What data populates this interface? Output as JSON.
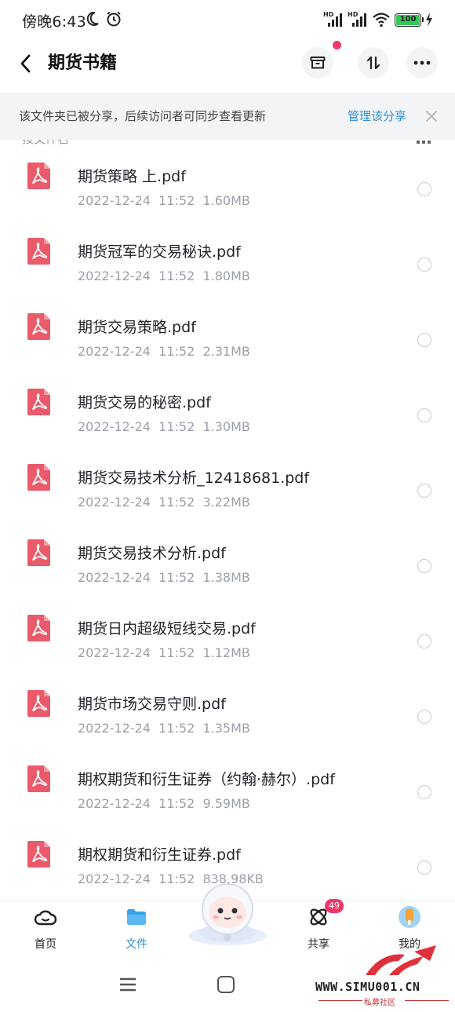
{
  "status_bar": {
    "time": "傍晚6:43",
    "moon_icon": "moon-icon",
    "alarm_icon": "alarm-icon",
    "signal_label_1": "HD",
    "signal_label_2": "HD",
    "battery_level": "100"
  },
  "header": {
    "title": "期货书籍",
    "back_icon": "chevron-left-icon",
    "actions": [
      "archive-box-icon",
      "sort-arrows-icon",
      "more-dots-icon"
    ]
  },
  "banner": {
    "text": "该文件夹已被分享，后续访问者可同步查看更新",
    "link": "管理该分享"
  },
  "sort": {
    "label": "按文件名"
  },
  "files": [
    {
      "name": "期货策略  上.pdf",
      "date": "2022-12-24",
      "time": "11:52",
      "size": "1.60MB"
    },
    {
      "name": "期货冠军的交易秘诀.pdf",
      "date": "2022-12-24",
      "time": "11:52",
      "size": "1.80MB"
    },
    {
      "name": "期货交易策略.pdf",
      "date": "2022-12-24",
      "time": "11:52",
      "size": "2.31MB"
    },
    {
      "name": "期货交易的秘密.pdf",
      "date": "2022-12-24",
      "time": "11:52",
      "size": "1.30MB"
    },
    {
      "name": "期货交易技术分析_12418681.pdf",
      "date": "2022-12-24",
      "time": "11:52",
      "size": "3.22MB"
    },
    {
      "name": "期货交易技术分析.pdf",
      "date": "2022-12-24",
      "time": "11:52",
      "size": "1.38MB"
    },
    {
      "name": "期货日内超级短线交易.pdf",
      "date": "2022-12-24",
      "time": "11:52",
      "size": "1.12MB"
    },
    {
      "name": "期货市场交易守则.pdf",
      "date": "2022-12-24",
      "time": "11:52",
      "size": "1.35MB"
    },
    {
      "name": "期权期货和衍生证券（约翰·赫尔）.pdf",
      "date": "2022-12-24",
      "time": "11:52",
      "size": "9.59MB"
    },
    {
      "name": "期权期货和衍生证券.pdf",
      "date": "2022-12-24",
      "time": "11:52",
      "size": "838.98KB"
    }
  ],
  "bottom_nav": [
    {
      "label": "首页",
      "icon": "home-cloud-icon"
    },
    {
      "label": "文件",
      "icon": "folder-icon",
      "active": true
    },
    {
      "label": "",
      "icon": "mascot-icon"
    },
    {
      "label": "共享",
      "icon": "share-atom-icon",
      "badge": "49"
    },
    {
      "label": "我的",
      "icon": "avatar-icon"
    }
  ],
  "watermark": {
    "url": "WWW.SIMU001.CN",
    "subtitle": "私募社区"
  },
  "colors": {
    "accent": "#2f8ed6",
    "pdf_red": "#ea5a6a",
    "badge": "#f0386a",
    "text_secondary": "#9aa0a8"
  }
}
